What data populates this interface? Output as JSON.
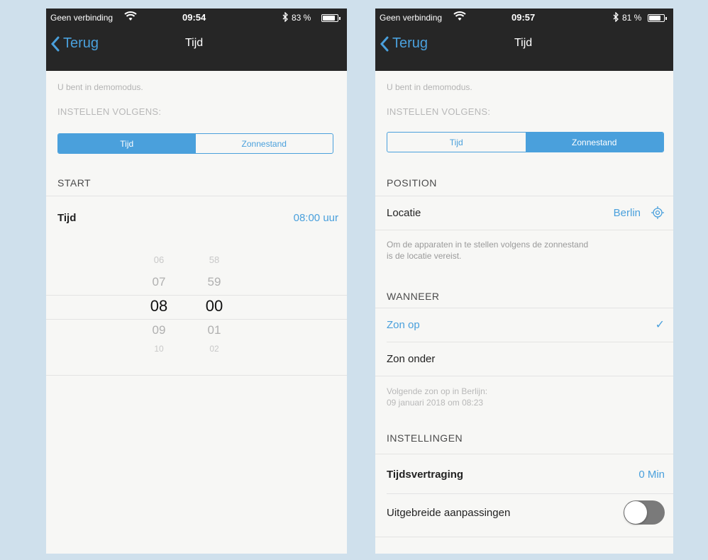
{
  "left": {
    "status": {
      "carrier": "Geen verbinding",
      "time": "09:54",
      "battery": "83 %"
    },
    "nav": {
      "back": "Terug",
      "title": "Tijd"
    },
    "demo": "U bent in demomodus.",
    "instellen": "INSTELLEN VOLGENS:",
    "segments": {
      "tijd": "Tijd",
      "zonnestand": "Zonnestand"
    },
    "start_header": "START",
    "tijd_row": {
      "label": "Tijd",
      "value": "08:00 uur"
    },
    "picker": {
      "hours": [
        "06",
        "07",
        "08",
        "09",
        "10"
      ],
      "minutes": [
        "58",
        "59",
        "00",
        "01",
        "02"
      ]
    }
  },
  "right": {
    "status": {
      "carrier": "Geen verbinding",
      "time": "09:57",
      "battery": "81 %"
    },
    "nav": {
      "back": "Terug",
      "title": "Tijd"
    },
    "demo": "U bent in demomodus.",
    "instellen": "INSTELLEN VOLGENS:",
    "segments": {
      "tijd": "Tijd",
      "zonnestand": "Zonnestand"
    },
    "position_header": "POSITION",
    "locatie_row": {
      "label": "Locatie",
      "value": "Berlin"
    },
    "locatie_note_1": "Om de apparaten in te stellen volgens de zonnestand",
    "locatie_note_2": "is de locatie vereist.",
    "wanneer_header": "WANNEER",
    "zon_op": "Zon op",
    "zon_onder": "Zon onder",
    "volgende_1": "Volgende zon op in Berlijn:",
    "volgende_2": "09 januari 2018 om 08:23",
    "instellingen_header": "INSTELLINGEN",
    "vertraging_row": {
      "label": "Tijdsvertraging",
      "value": "0 Min"
    },
    "uitgebreide": "Uitgebreide aanpassingen"
  },
  "colors": {
    "accent": "#4aa0dc",
    "nav_bg": "#262626",
    "page_bg": "#cfe0ec"
  },
  "icons": [
    "wifi-icon",
    "bluetooth-icon",
    "battery-icon",
    "chevron-left-icon",
    "location-target-icon",
    "checkmark-icon"
  ]
}
